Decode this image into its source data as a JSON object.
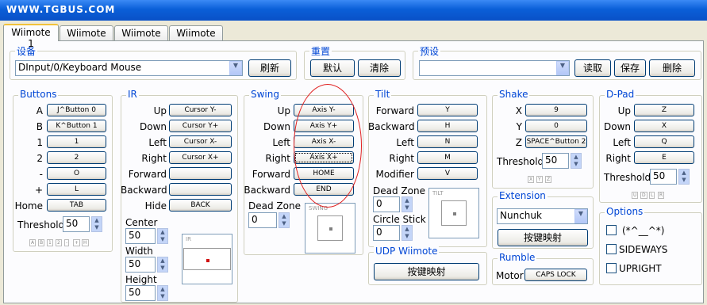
{
  "window": {
    "title": "WWW.TGBUS.COM"
  },
  "tabs": [
    "Wiimote 1",
    "Wiimote 2",
    "Wiimote 3",
    "Wiimote 4"
  ],
  "device": {
    "title": "设备",
    "value": "DInput/0/Keyboard Mouse",
    "refresh": "刷新"
  },
  "reset": {
    "title": "重置",
    "default": "默认",
    "clear": "清除"
  },
  "preset": {
    "title": "预设",
    "value": "",
    "load": "读取",
    "save": "保存",
    "delete": "删除"
  },
  "buttons": {
    "title": "Buttons",
    "rows": [
      {
        "label": "A",
        "value": "J^Button 0"
      },
      {
        "label": "B",
        "value": "K^Button 1"
      },
      {
        "label": "1",
        "value": "1"
      },
      {
        "label": "2",
        "value": "2"
      },
      {
        "label": "-",
        "value": "O"
      },
      {
        "label": "+",
        "value": "L"
      },
      {
        "label": "Home",
        "value": "TAB"
      }
    ],
    "threshold_label": "Threshold",
    "threshold": "50",
    "mini": [
      "A",
      "B",
      "1",
      "2",
      "-",
      "+",
      "H"
    ]
  },
  "ir": {
    "title": "IR",
    "rows": [
      {
        "label": "Up",
        "value": "Cursor Y-"
      },
      {
        "label": "Down",
        "value": "Cursor Y+"
      },
      {
        "label": "Left",
        "value": "Cursor X-"
      },
      {
        "label": "Right",
        "value": "Cursor X+"
      },
      {
        "label": "Forward",
        "value": ""
      },
      {
        "label": "Backward",
        "value": ""
      },
      {
        "label": "Hide",
        "value": "BACK"
      }
    ],
    "center_label": "Center",
    "center": "50",
    "width_label": "Width",
    "width": "50",
    "height_label": "Height",
    "height": "50",
    "preview_caption": "IR"
  },
  "swing": {
    "title": "Swing",
    "rows": [
      {
        "label": "Up",
        "value": "Axis Y-"
      },
      {
        "label": "Down",
        "value": "Axis Y+"
      },
      {
        "label": "Left",
        "value": "Axis X-"
      },
      {
        "label": "Right",
        "value": "Axis X+"
      },
      {
        "label": "Forward",
        "value": "HOME"
      },
      {
        "label": "Backward",
        "value": "END"
      }
    ],
    "deadzone_label": "Dead Zone",
    "deadzone": "0",
    "preview_caption": "SWING"
  },
  "tilt": {
    "title": "Tilt",
    "rows": [
      {
        "label": "Forward",
        "value": "Y"
      },
      {
        "label": "Backward",
        "value": "H"
      },
      {
        "label": "Left",
        "value": "N"
      },
      {
        "label": "Right",
        "value": "M"
      },
      {
        "label": "Modifier",
        "value": "V"
      }
    ],
    "deadzone_label": "Dead Zone",
    "deadzone": "0",
    "circle_label": "Circle Stick",
    "circle": "0",
    "preview_caption": "TILT"
  },
  "udp": {
    "title": "UDP Wiimote",
    "button": "按键映射"
  },
  "shake": {
    "title": "Shake",
    "rows": [
      {
        "label": "X",
        "value": "9"
      },
      {
        "label": "Y",
        "value": "0"
      },
      {
        "label": "Z",
        "value": "SPACE^Button 2"
      }
    ],
    "threshold_label": "Threshold",
    "threshold": "50",
    "mini": [
      "X",
      "Y",
      "Z"
    ]
  },
  "extension": {
    "title": "Extension",
    "value": "Nunchuk",
    "button": "按键映射"
  },
  "rumble": {
    "title": "Rumble",
    "motor_label": "Motor",
    "motor": "CAPS LOCK"
  },
  "dpad": {
    "title": "D-Pad",
    "rows": [
      {
        "label": "Up",
        "value": "Z"
      },
      {
        "label": "Down",
        "value": "X"
      },
      {
        "label": "Left",
        "value": "Q"
      },
      {
        "label": "Right",
        "value": "E"
      }
    ],
    "threshold_label": "Threshold",
    "threshold": "50",
    "mini": [
      "U",
      "D",
      "L",
      "R"
    ]
  },
  "options": {
    "title": "Options",
    "items": [
      {
        "label": "(*^__^*)",
        "checked": false
      },
      {
        "label": "SIDEWAYS",
        "checked": false
      },
      {
        "label": "UPRIGHT",
        "checked": false
      }
    ]
  },
  "watermark": "TGBUS"
}
